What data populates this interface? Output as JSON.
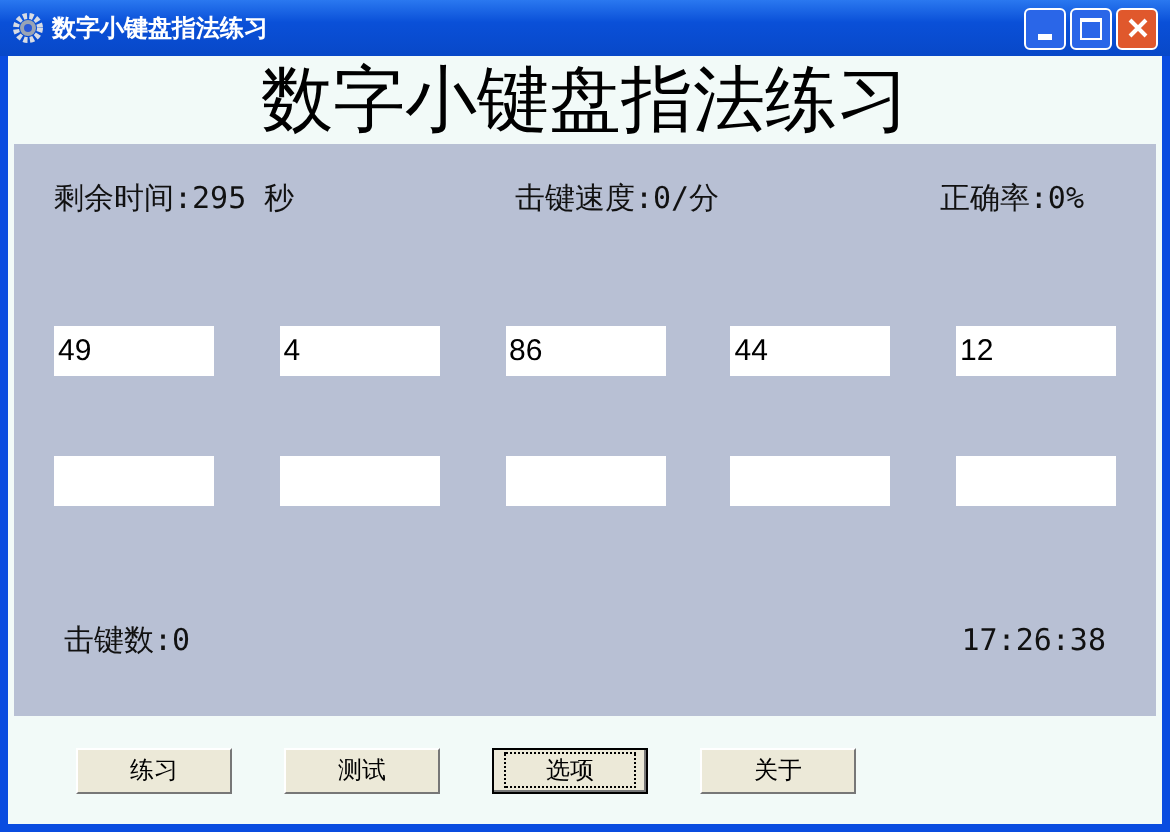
{
  "window": {
    "title": "数字小键盘指法练习"
  },
  "heading": "数字小键盘指法练习",
  "stats": {
    "remaining_time": "剩余时间:295 秒",
    "speed": "击键速度:0/分",
    "accuracy": "正确率:0%"
  },
  "prompt_fields": [
    {
      "value": "49"
    },
    {
      "value": "4"
    },
    {
      "value": "86"
    },
    {
      "value": "44"
    },
    {
      "value": "12"
    }
  ],
  "keystrokes": "击键数:0",
  "clock": "17:26:38",
  "buttons": [
    {
      "label": "练习",
      "selected": false
    },
    {
      "label": "测试",
      "selected": false
    },
    {
      "label": "选项",
      "selected": true
    },
    {
      "label": "关于",
      "selected": false
    }
  ]
}
